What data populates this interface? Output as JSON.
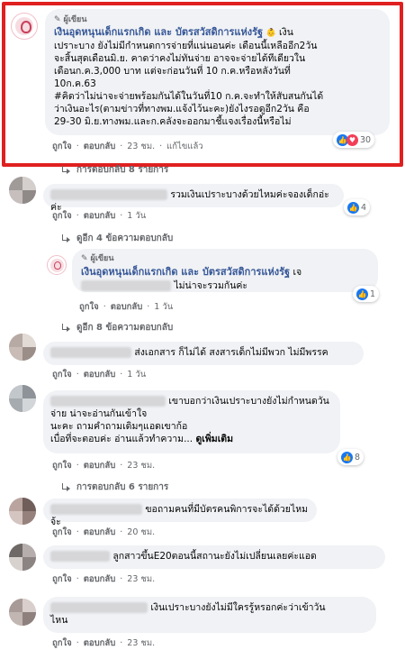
{
  "top_comment": {
    "author_badge": "ผู้เขียน",
    "author_name": "เงินอุดหนุนเด็กแรกเกิด และ บัตรสวัสดิการแห่งรัฐ",
    "lines": [
      "เงิน",
      "เปราะบาง ยังไม่มีกำหนดการจ่ายที่แน่นอนค่ะ เดือนนี้เหลืออีก2วัน",
      "จะสิ้นสุดเดือนมิ.ย. คาดว่าคงไม่ทันจ่าย อาจจะจ่ายได้ทีเดียวใน",
      "เดือนก.ค.3,000 บาท แต่จะก่อนวันที่ 10 ก.ค.หรือหลังวันที่",
      "10ก.ค.63",
      "#คิดว่าไม่น่าจะจ่ายพร้อมกันได้ในวันที่10 ก.ค.จะทำให้สับสนกันได้",
      "ว่าเงินอะไร(ตามข่าวที่ทางพม.แจ้งไว้นะคะ)ยังไงรอดูอีก2วัน คือ",
      "29-30 มิ.ย.ทางพม.และก.คลังจะออกมาชี้แจงเรื่องนี้หรือไม่"
    ],
    "like": "ถูกใจ",
    "reply": "ตอบกลับ",
    "time": "23 ชม.",
    "edited": "แก้ไขแล้ว",
    "reaction_count": "30"
  },
  "top_replies_link": "การตอบกลับ 8 รายการ",
  "comments": [
    {
      "text": "รวมเงินเปราะบางด้วยไหมค่ะจองเด็กอ่ะค่ะ",
      "like": "ถูกใจ",
      "reply": "ตอบกลับ",
      "time": "1 วัน",
      "reaction_count": "4"
    }
  ],
  "prev_replies_1": "ดูอีก 4 ข้อความตอบกลับ",
  "page_reply": {
    "author_badge": "ผู้เขียน",
    "author_name": "เงินอุดหนุนเด็กแรกเกิด และ บัตรสวัสดิการแห่งรัฐ",
    "name_suffix": "เจ",
    "text": "ไม่น่าจะรวมกันค่ะ",
    "like": "ถูกใจ",
    "reply": "ตอบกลับ",
    "time": "1 วัน",
    "reaction_count": "1"
  },
  "prev_replies_2": "ดูอีก 8 ข้อความตอบกลับ",
  "comment_2": {
    "text": "ส่งเอกสาร ก็ไม่ได้ สงสารเด็กไม่มีพวก ไม่มีพรรค",
    "like": "ถูกใจ",
    "reply": "ตอบกลับ",
    "time": "1 วัน"
  },
  "comment_3": {
    "line1": "เขาบอกว่าเงินเปราะบางยังไม่กำหนดวัน",
    "line2": "จ่าย น่าจะอ่านกันเข้าใจ",
    "line3": "นะคะ ถามคำถามเดิมๆแอดเขาก้อ",
    "line4": "เบื่อที่จะตอบค่ะ อ่านแล้วทำความ...",
    "see_more": "ดูเพิ่มเติม",
    "like": "ถูกใจ",
    "reply": "ตอบกลับ",
    "time": "23 ชม.",
    "reaction_count": "8"
  },
  "comment_3_replies": "การตอบกลับ 6 รายการ",
  "comment_4": {
    "text": "ขอถามคนที่มีบัตรคนพิการจะได้ด้วยไหมจ้ะ",
    "like": "ถูกใจ",
    "reply": "ตอบกลับ",
    "time": "20 ชม."
  },
  "comment_5": {
    "text": "ลูกสาวขึ้นE20ตอนนี้สถานะยังไม่เปลี่ยนเลยค่ะแอด",
    "like": "ถูกใจ",
    "reply": "ตอบกลับ",
    "time": "23 ชม."
  },
  "comment_6": {
    "line1": "เงินเปราะบางยังไม่มีใครรู้หรอกค่ะว่าเข้าวัน",
    "line2": "ไหน",
    "like": "ถูกใจ",
    "reply": "ตอบกลับ",
    "time": "23 ชม."
  },
  "colors": {
    "highlight": "#e02020",
    "link": "#385898",
    "like_blue": "#1877f2",
    "love_red": "#f33e58"
  }
}
